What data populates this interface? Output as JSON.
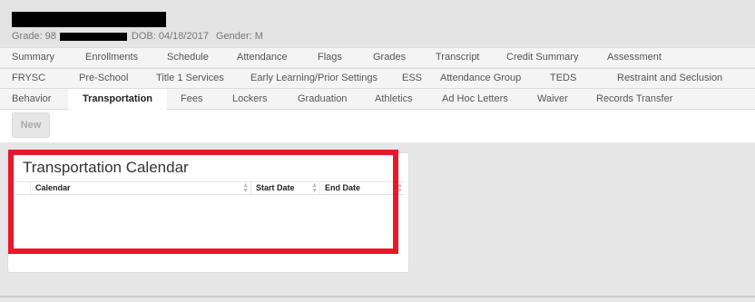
{
  "student": {
    "grade_label": "Grade: 98",
    "dob_label": "DOB:",
    "dob_value": "04/18/2017",
    "gender_label": "Gender:",
    "gender_value": "M"
  },
  "tabs": {
    "row1": [
      "Summary",
      "Enrollments",
      "Schedule",
      "Attendance",
      "Flags",
      "Grades",
      "Transcript",
      "Credit Summary",
      "Assessment"
    ],
    "row2": [
      "FRYSC",
      "Pre-School",
      "Title 1 Services",
      "Early Learning/Prior Settings",
      "ESS",
      "Attendance Group",
      "TEDS",
      "Restraint and Seclusion"
    ],
    "row3": [
      "Behavior",
      "Transportation",
      "Fees",
      "Lockers",
      "Graduation",
      "Athletics",
      "Ad Hoc Letters",
      "Waiver",
      "Records Transfer"
    ],
    "active": "Transportation"
  },
  "toolbar": {
    "new_label": "New"
  },
  "panel": {
    "title": "Transportation Calendar",
    "columns": [
      "Calendar",
      "Start Date",
      "End Date"
    ],
    "rows": []
  },
  "colors": {
    "highlight": "#e8182a",
    "background": "#e6e6e6"
  },
  "icons": {
    "sort": "sort-icon"
  }
}
